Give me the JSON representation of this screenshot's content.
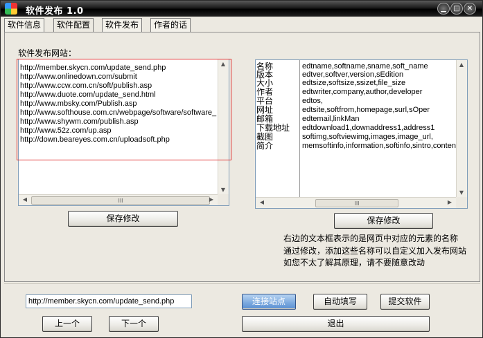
{
  "window": {
    "title": "软件发布 1.0"
  },
  "controls": {
    "minimize": "▁",
    "maximize": "□",
    "close": "✕"
  },
  "tabs": [
    "软件信息",
    "软件配置",
    "软件发布",
    "作者的话"
  ],
  "main": {
    "sites_label": "软件发布网站：",
    "urls": [
      "http://member.skycn.com/update_send.php",
      "http://www.onlinedown.com/submit",
      "http://www.ccw.com.cn/soft/publish.asp",
      "http://www.duote.com/update_send.html",
      "http://www.mbsky.com/Publish.asp",
      "http://www.softhouse.com.cn/webpage/software/software_",
      "http://www.shywm.com/publish.asp",
      "http://www.52z.com/up.asp",
      "http://down.beareyes.com.cn/uploadsoft.php"
    ],
    "mapping_names": [
      "名称",
      "版本",
      "大小",
      "作者",
      "平台",
      "网址",
      "邮箱",
      "下载地址",
      "截图",
      "简介"
    ],
    "mapping_values": [
      "edtname,softname,sname,soft_name",
      "edtver,softver,version,sEdition",
      "edtsize,softsize,ssizet,file_size",
      "edtwriter,company,author,developer",
      "edtos,",
      "edtsite,softfrom,homepage,surl,sOper",
      "edtemail,linkMan",
      "edtdownload1,downaddress1,address1",
      "softimg,softviewimg,images,image_url,",
      "memsoftinfo,information,softinfo,sintro,content,c"
    ],
    "save_left": "保存修改",
    "save_right": "保存修改",
    "note_lines": [
      "右边的文本框表示的是网页中对应的元素的名称",
      "通过修改，添加这些名称可以自定义加入发布网站",
      "如您不太了解其原理，请不要随意改动"
    ]
  },
  "bottom": {
    "current_url": "http://member.skycn.com/update_send.php",
    "prev": "上一个",
    "next": "下一个",
    "connect": "连接站点",
    "autofill": "自动填写",
    "submit": "提交软件",
    "exit": "退出"
  },
  "scroll": {
    "thumb_grip": "III",
    "up": "▲",
    "down": "▼",
    "left": "◀",
    "right": "▶"
  }
}
